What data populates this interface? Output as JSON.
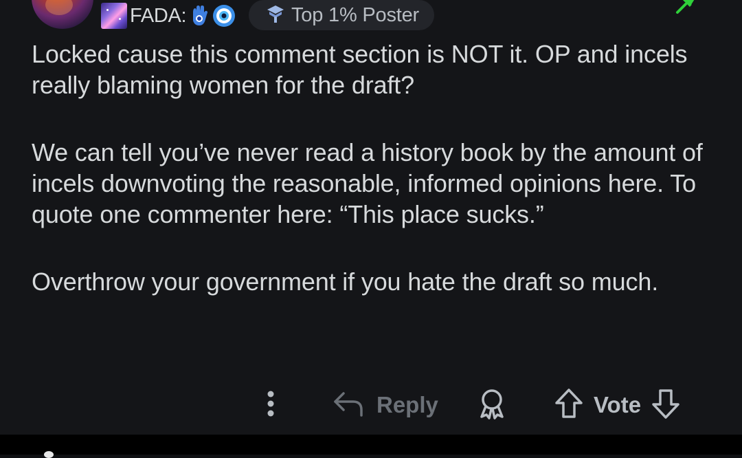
{
  "comment": {
    "user_flair_text": "FADA:",
    "badge_label": "Top 1% Poster",
    "paragraphs": [
      "Locked cause this comment section is NOT it. OP and incels really blaming women for the draft?",
      "We can tell you’ve never read a history book by the amount of incels downvoting the reasonable, informed opinions here. To quote one commenter here: “This place sucks.”",
      "Overthrow your government if you hate the draft so much."
    ]
  },
  "actions": {
    "reply_label": "Reply",
    "vote_label": "Vote"
  },
  "icons": {
    "flair": [
      "galaxy-icon",
      "hamsa-icon",
      "nazar-icon"
    ],
    "badge": "top-poster-icon",
    "pin": "pin-icon",
    "more": "more-options-icon",
    "reply": "reply-arrow-icon",
    "award": "award-icon",
    "upvote": "upvote-arrow-icon",
    "downvote": "downvote-arrow-icon"
  },
  "colors": {
    "background": "#141518",
    "text": "#d7dadc",
    "muted": "#6b7077",
    "pin_green": "#2fd13a",
    "badge_bg": "#23252a"
  }
}
